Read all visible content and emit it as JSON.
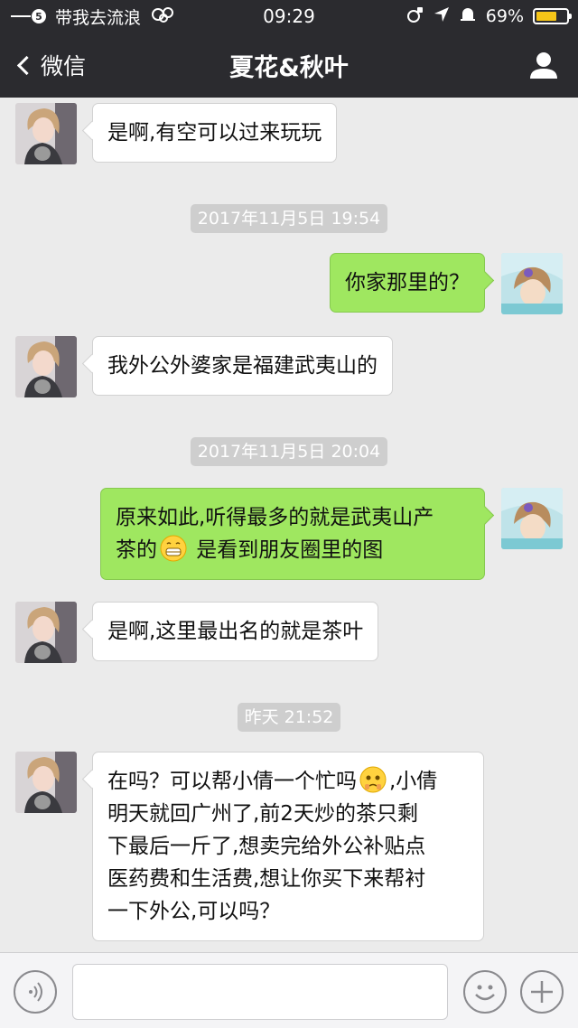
{
  "status_bar": {
    "carrier": "带我去流浪",
    "signal_badge": "5",
    "time": "09:29",
    "battery_label": "69%",
    "battery_level_percent": 69,
    "battery_color": "#f5c518"
  },
  "nav": {
    "back_label": "微信",
    "title": "夏花&秋叶",
    "profile_icon": "person-icon"
  },
  "messages": [
    {
      "side": "left",
      "text": "是啊,有空可以过来玩玩"
    },
    {
      "timestamp": "2017年11月5日 19:54"
    },
    {
      "side": "right",
      "text": "你家那里的？"
    },
    {
      "side": "left",
      "text": "我外公外婆家是福建武夷山的"
    },
    {
      "timestamp": "2017年11月5日 20:04"
    },
    {
      "side": "right",
      "text_line1": "原来如此,听得最多的就是武夷山产",
      "text_line2_before": "茶的",
      "emoji": "grin-emoji",
      "text_line2_after": " 是看到朋友圈里的图"
    },
    {
      "side": "left",
      "text": "是啊,这里最出名的就是茶叶"
    },
    {
      "timestamp": "昨天 21:52"
    },
    {
      "side": "left",
      "line1_before": "在吗？可以帮小倩一个忙吗",
      "emoji": "pleading-emoji",
      "line1_after": ",小倩",
      "line2": "明天就回广州了,前2天炒的茶只剩",
      "line3": "下最后一斤了,想卖完给外公补贴点",
      "line4": "医药费和生活费,想让你买下来帮衬",
      "line5": "一下外公,可以吗？"
    }
  ],
  "input_bar": {
    "voice_icon": "voice-icon",
    "text_value": "",
    "emoji_icon": "smiley-icon",
    "more_icon": "plus-icon"
  },
  "colors": {
    "header_bg": "#2b2b2f",
    "chat_bg": "#ebebeb",
    "sent_bubble": "#9fe760",
    "received_bubble": "#ffffff",
    "timestamp_bg": "#cecece"
  }
}
